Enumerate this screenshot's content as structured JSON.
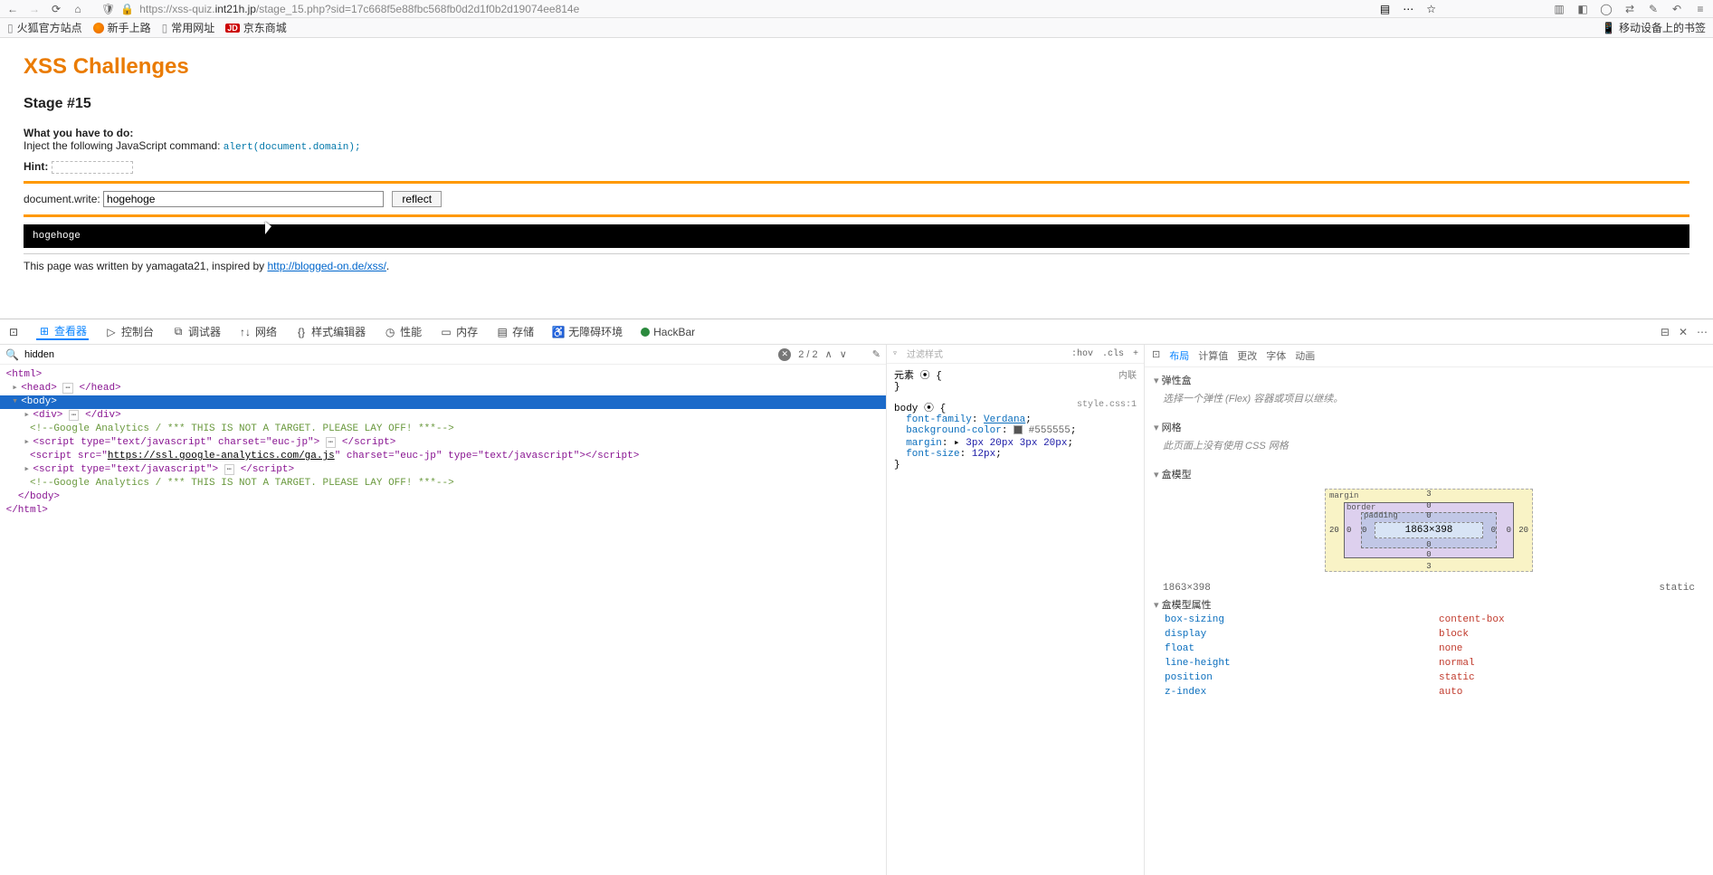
{
  "browser": {
    "url_proto": "https://",
    "url_pre": "xss-quiz.",
    "url_domain": "int21h.jp",
    "url_path": "/stage_15.php?sid=17c668f5e88fbc568fb0d2d1f0b2d19074ee814e",
    "bookmarks": {
      "b1": "火狐官方站点",
      "b2": "新手上路",
      "b3": "常用网址",
      "b4": "京东商城",
      "right": "移动设备上的书签"
    }
  },
  "page": {
    "title": "XSS Challenges",
    "stage": "Stage #15",
    "todo_label": "What you have to do:",
    "todo_text": "Inject the following JavaScript command: ",
    "todo_code": "alert(document.domain);",
    "hint_label": "Hint:",
    "form_label": "document.write:",
    "form_value": "hogehoge",
    "form_button": "reflect",
    "output": "hogehoge",
    "footer_pre": "This page was written by yamagata21, inspired by ",
    "footer_link": "http://blogged-on.de/xss/",
    "footer_suffix": "."
  },
  "devtools": {
    "tabs": {
      "inspector": "查看器",
      "console": "控制台",
      "debugger": "调试器",
      "network": "网络",
      "style_editor": "样式编辑器",
      "performance": "性能",
      "memory": "内存",
      "storage": "存储",
      "a11y": "无障碍环境",
      "hackbar": "HackBar"
    },
    "search_value": "hidden",
    "search_count": "2 / 2",
    "filter_placeholder": "过滤样式",
    "styles": {
      "hov": ":hov",
      "cls": ".cls",
      "inline": "内联",
      "element_label": "元素",
      "body_sel": "body",
      "src": "style.css:1",
      "font_family_k": "font-family",
      "font_family_v": "Verdana",
      "bg_k": "background-color",
      "bg_v": "#555555",
      "margin_k": "margin",
      "margin_v": "3px 20px 3px 20px",
      "fs_k": "font-size",
      "fs_v": "12px"
    },
    "layout": {
      "tab_layout": "布局",
      "tab_computed": "计算值",
      "tab_changes": "更改",
      "tab_fonts": "字体",
      "tab_anim": "动画",
      "flex_hdr": "弹性盒",
      "flex_msg": "选择一个弹性 (Flex) 容器或项目以继续。",
      "grid_hdr": "网格",
      "grid_msg": "此页面上没有使用 CSS 网格",
      "box_hdr": "盒模型",
      "margin_lbl": "margin",
      "border_lbl": "border",
      "padding_lbl": "padding",
      "content_dim": "1863×398",
      "m_top": "3",
      "m_right": "20",
      "m_bottom": "3",
      "m_left": "20",
      "b_top": "0",
      "b_right": "0",
      "b_bottom": "0",
      "b_left": "0",
      "p_top": "0",
      "p_right": "0",
      "p_bottom": "0",
      "p_left": "0",
      "dims": "1863×398",
      "pos": "static",
      "props_hdr": "盒模型属性",
      "box_sizing_k": "box-sizing",
      "box_sizing_v": "content-box",
      "display_k": "display",
      "display_v": "block",
      "float_k": "float",
      "float_v": "none",
      "lh_k": "line-height",
      "lh_v": "normal",
      "position_k": "position",
      "position_v": "static",
      "zindex_k": "z-index",
      "zindex_v": "auto"
    },
    "dom": {
      "html_open": "<html>",
      "head": "<head>",
      "head_close": "</head>",
      "body_open": "<body>",
      "div": "<div>",
      "div_close": "</div>",
      "comment": "<!--Google Analytics / *** THIS IS NOT A TARGET. PLEASE LAY OFF! ***-->",
      "script1": "<script type=\"text/javascript\" charset=\"euc-jp\">",
      "script1_c": "</script>",
      "script2_a": "<script src=\"",
      "script2_url": "https://ssl.google-analytics.com/ga.js",
      "script2_b": "\" charset=\"euc-jp\" type=\"text/javascript\">",
      "script2_c": "</script>",
      "script3": "<script type=\"text/javascript\">",
      "script3_c": "</script>",
      "body_close": "</body>",
      "html_close": "</html>"
    }
  }
}
